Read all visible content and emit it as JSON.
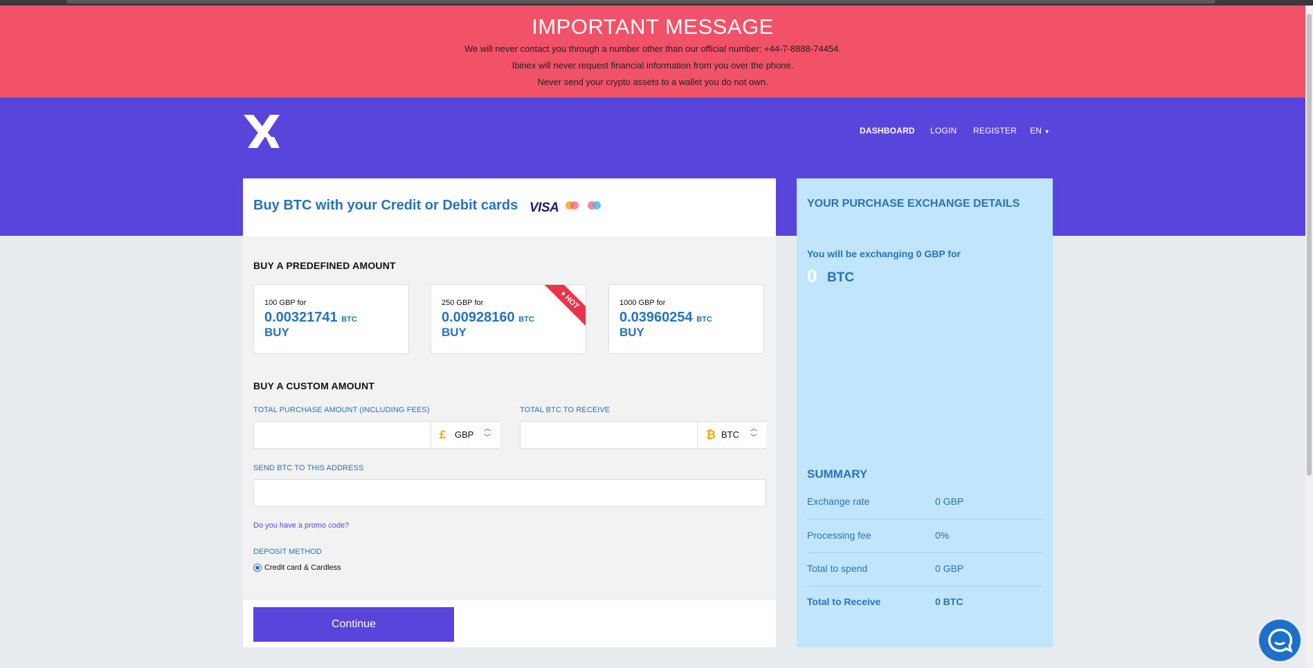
{
  "banner": {
    "title": "IMPORTANT MESSAGE",
    "lines": [
      "We will never contact you through a number other than our official number: +44-7-8888-74454.",
      "Ibinex will never request financial information from you over the phone.",
      "Never send your crypto assets to a wallet you do not own."
    ]
  },
  "nav": {
    "items": [
      "DASHBOARD",
      "LOGIN",
      "REGISTER",
      "EN"
    ]
  },
  "buy_card": {
    "title": "Buy BTC with your Credit or Debit cards",
    "visa": "VISA",
    "predefined_title": "BUY A PREDEFINED AMOUNT",
    "predefined": [
      {
        "for": "100 GBP for",
        "amount": "0.00321741",
        "unit": "BTC",
        "buy": "BUY",
        "hot": false
      },
      {
        "for": "250 GBP for",
        "amount": "0.00928160",
        "unit": "BTC",
        "buy": "BUY",
        "hot": true
      },
      {
        "for": "1000 GBP for",
        "amount": "0.03960254",
        "unit": "BTC",
        "buy": "BUY",
        "hot": false
      }
    ],
    "hot_label": "HOT",
    "custom_title": "BUY A CUSTOM AMOUNT",
    "purchase_label": "TOTAL PURCHASE AMOUNT (INCLUDING FEES)",
    "purchase_value": "",
    "purchase_currency_symbol": "£",
    "purchase_currency": "GBP",
    "receive_label": "TOTAL BTC TO RECEIVE",
    "receive_value": "",
    "receive_currency_symbol": "₿",
    "receive_currency": "BTC",
    "address_label": "SEND BTC TO THIS ADDRESS",
    "address_value": "",
    "promo": "Do you have a promo code?",
    "deposit_label": "DEPOSIT METHOD",
    "deposit_option": "Credit card & Cardless",
    "continue": "Continue"
  },
  "side": {
    "title": "YOUR PURCHASE EXCHANGE DETAILS",
    "exchanging": "You will be exchanging 0 GBP for",
    "btc_amount": "0",
    "btc_unit": "BTC",
    "summary_title": "SUMMARY",
    "summary": [
      {
        "k": "Exchange rate",
        "v": "0 GBP"
      },
      {
        "k": "Processing fee",
        "v": "0%"
      },
      {
        "k": "Total to spend",
        "v": "0 GBP"
      },
      {
        "k": "Total to Receive",
        "v": "0 BTC"
      }
    ]
  },
  "colors": {
    "banner": "#f25268",
    "brand": "#5a45dc",
    "accent_blue": "#2772b8",
    "side_bg": "#c1e6fb",
    "hot": "#e8354c",
    "chat": "#1d70c9"
  }
}
